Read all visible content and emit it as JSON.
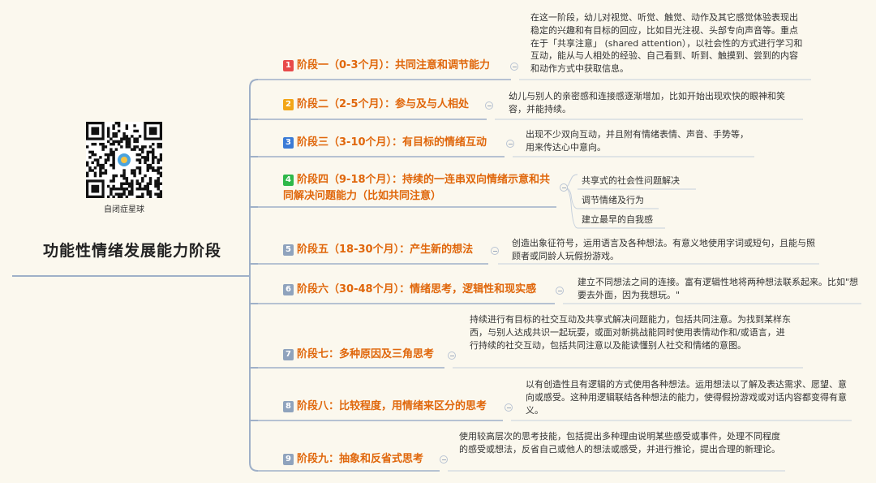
{
  "qr_label": "自闭症星球",
  "root_title": "功能性情绪发展能力阶段",
  "colors": {
    "accent": "#e0670c",
    "line": "#9fb0c8",
    "background": "#fbf8ee"
  },
  "stages": [
    {
      "num": "1",
      "badge_color": "#e84a4a",
      "title": "阶段一（0-3个月）：共同注意和调节能力",
      "desc": "在这一阶段，幼儿对视觉、听觉、触觉、动作及其它感觉体验表现出稳定的兴趣和有目标的回应，比如目光注视、头部专向声音等。重点在于「共享注意」 (shared attention），以社会性的方式进行学习和互动，能从与人相处的经验、自己看到、听到、触摸到、尝到的内容和动作方式中获取信息。"
    },
    {
      "num": "2",
      "badge_color": "#f2a516",
      "title": "阶段二（2-5个月）：参与及与人相处",
      "desc": "幼儿与别人的亲密感和连接感逐渐增加，比如开始出现欢快的眼神和笑容，并能持续。"
    },
    {
      "num": "3",
      "badge_color": "#3b7bd6",
      "title": "阶段三（3-10个月）：有目标的情绪互动",
      "desc": "出现不少双向互动，并且附有情绪表情、声音、手势等，用来传达心中意向。"
    },
    {
      "num": "4",
      "badge_color": "#2eb84a",
      "title": "阶段四（9-18个月）：持续的一连串双向情绪示意和共同解决问题能力（比如共同注意）",
      "leaves": [
        "共享式的社会性问题解决",
        "调节情绪及行为",
        "建立最早的自我感"
      ]
    },
    {
      "num": "5",
      "badge_color": "#8fa3bd",
      "title": "阶段五（18-30个月）：产生新的想法",
      "desc": "创造出象征符号，运用语言及各种想法。有意义地使用字词或短句，且能与照顾者或同龄人玩假扮游戏。"
    },
    {
      "num": "6",
      "badge_color": "#8fa3bd",
      "title": "阶段六（30-48个月）：情绪思考，逻辑性和现实感",
      "desc": "建立不同想法之间的连接。富有逻辑性地将两种想法联系起来。比如\"想要去外面，因为我想玩。\""
    },
    {
      "num": "7",
      "badge_color": "#8fa3bd",
      "title": "阶段七：多种原因及三角思考",
      "desc": "持续进行有目标的社交互动及共享式解决问题能力，包括共同注意。为找到某样东西，与别人达成共识一起玩耍，或面对新挑战能同时使用表情动作和/或语言，进行持续的社交互动，包括共同注意以及能读懂别人社交和情绪的意图。"
    },
    {
      "num": "8",
      "badge_color": "#8fa3bd",
      "title": "阶段八：比较程度，用情绪来区分的思考",
      "desc": "以有创造性且有逻辑的方式使用各种想法。运用想法以了解及表达需求、愿望、意向或感受。这种用逻辑联结各种想法的能力，使得假扮游戏或对话内容都变得有意义。"
    },
    {
      "num": "9",
      "badge_color": "#8fa3bd",
      "title": "阶段九：抽象和反省式思考",
      "desc": "使用较高层次的思考技能，包括提出多种理由说明某些感受或事件，处理不同程度的感受或想法，反省自己或他人的想法或感受，并进行推论，提出合理的新理论。"
    }
  ]
}
